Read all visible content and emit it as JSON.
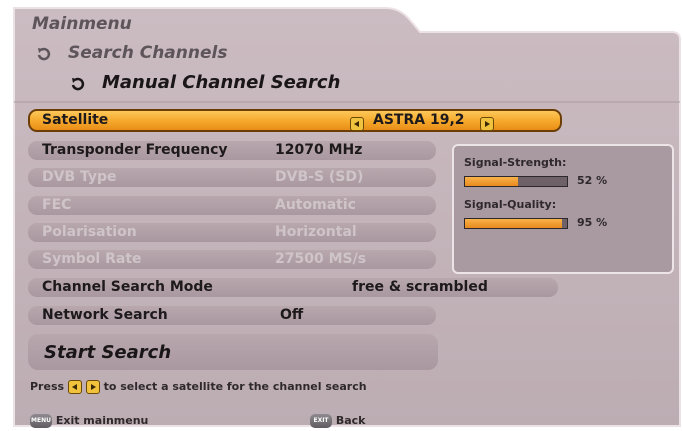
{
  "breadcrumb": {
    "root": "Mainmenu",
    "parent": "Search Channels",
    "current": "Manual Channel Search"
  },
  "settings": {
    "satellite": {
      "label": "Satellite",
      "value": "ASTRA 19,2"
    },
    "transponder": {
      "label": "Transponder Frequency",
      "value": "12070 MHz"
    },
    "dvb_type": {
      "label": "DVB Type",
      "value": "DVB-S (SD)"
    },
    "fec": {
      "label": "FEC",
      "value": "Automatic"
    },
    "polarisation": {
      "label": "Polarisation",
      "value": "Horizontal"
    },
    "symbol_rate": {
      "label": "Symbol Rate",
      "value": "27500 MS/s"
    },
    "search_mode": {
      "label": "Channel Search Mode",
      "value": "free & scrambled"
    },
    "network_search": {
      "label": "Network Search",
      "value": "Off"
    }
  },
  "start_search": "Start Search",
  "signal": {
    "strength_label": "Signal-Strength:",
    "strength_text": "52 %",
    "strength_value": 52,
    "quality_label": "Signal-Quality:",
    "quality_text": "95 %",
    "quality_value": 95
  },
  "help": {
    "prefix": "Press",
    "suffix": "to select a satellite for the channel search"
  },
  "footer": {
    "menu_key": "MENU",
    "menu_label": "Exit mainmenu",
    "exit_key": "EXIT",
    "exit_label": "Back"
  },
  "colors": {
    "highlight": "#f5a72a",
    "panel": "#b4a4aa",
    "bar_fill": "#f0a030"
  },
  "icons": [
    "circular-arrow-icon",
    "arrow-left-icon",
    "arrow-right-icon",
    "menu-key-icon",
    "exit-key-icon"
  ]
}
